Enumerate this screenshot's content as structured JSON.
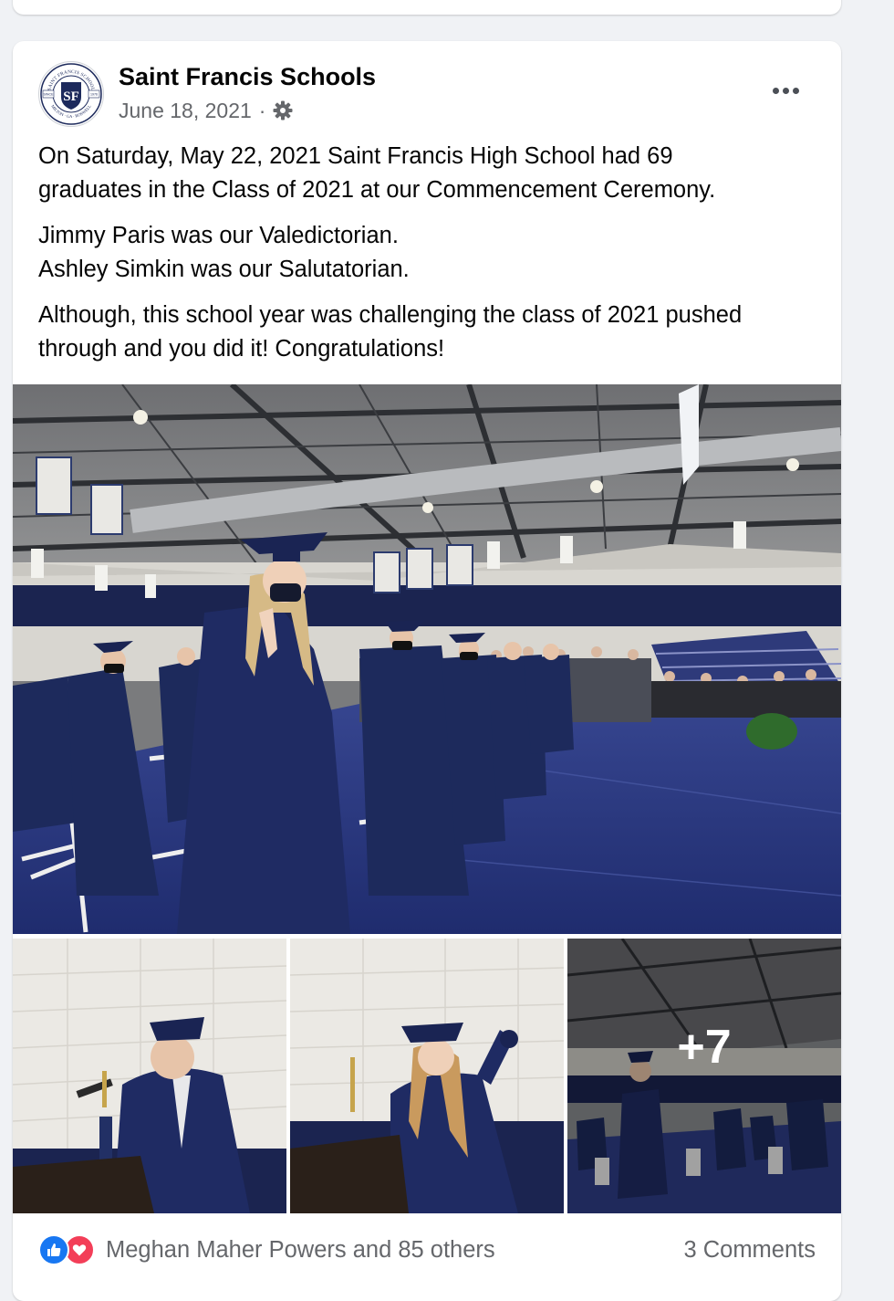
{
  "post": {
    "author": "Saint Francis Schools",
    "date": "June 18, 2021",
    "separator": "·",
    "audience_icon": "gear-icon",
    "menu_icon": "more-options-icon",
    "paragraphs": [
      [
        "On Saturday, May 22, 2021 Saint Francis High School had 69",
        "graduates in the Class of 2021 at our Commencement Ceremony."
      ],
      [
        "Jimmy Paris was our Valedictorian.",
        "Ashley Simkin was our Salutatorian."
      ],
      [
        "Although, this school year was challenging the class of 2021 pushed",
        "through and you did it! Congratulations!"
      ]
    ]
  },
  "logo": {
    "ring_text_top": "SAINT FRANCIS SCHOOL",
    "ring_text_bottom": "MILTON · GA · ROSWELL",
    "since_label": "SINCE",
    "year": "1976",
    "monogram": "SF"
  },
  "gallery": {
    "photos": [
      {
        "name": "graduates-ceremony-photo",
        "icon": "photo"
      },
      {
        "name": "valedictorian-speech-photo",
        "icon": "photo"
      },
      {
        "name": "salutatorian-speech-photo",
        "icon": "photo"
      },
      {
        "name": "graduate-walk-photo",
        "icon": "photo"
      }
    ],
    "more_count_label": "+7"
  },
  "footer": {
    "reactions_text": "Meghan Maher Powers and 85 others",
    "comments_text": "3 Comments",
    "reaction_icons": [
      "like-icon",
      "love-icon"
    ]
  },
  "colors": {
    "like": "#1877f2",
    "love": "#f33e58",
    "gown": "#1d2a5c",
    "floor": "#2b3a8a",
    "secondary_text": "#65676b"
  }
}
